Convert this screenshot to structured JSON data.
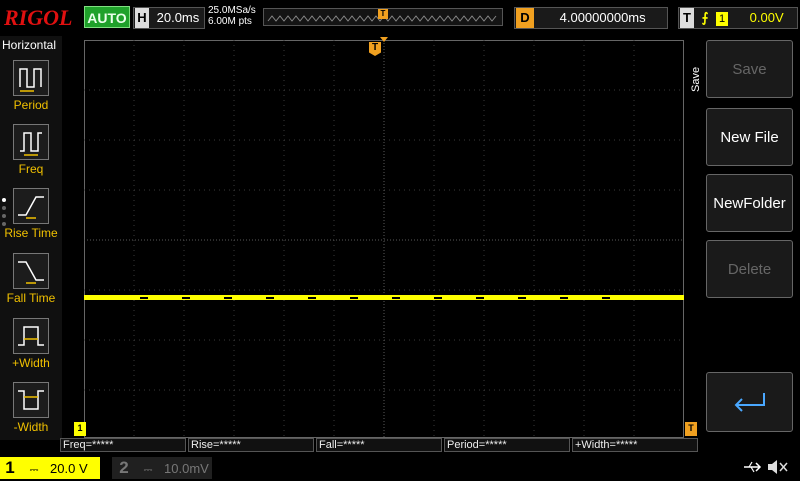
{
  "topbar": {
    "logo": "RIGOL",
    "run_mode": "AUTO",
    "h_label": "H",
    "timebase": "20.0ms",
    "sample_rate": "25.0MSa/s",
    "memory_depth": "6.00M pts",
    "trigger_marker": "T",
    "d_label": "D",
    "delay": "4.00000000ms",
    "t_label": "T",
    "trigger_source": "1",
    "trigger_level": "0.00V"
  },
  "left_menu": {
    "title": "Horizontal",
    "items": [
      {
        "label": "Period",
        "icon": "period-icon"
      },
      {
        "label": "Freq",
        "icon": "freq-icon"
      },
      {
        "label": "Rise Time",
        "icon": "rise-time-icon"
      },
      {
        "label": "Fall Time",
        "icon": "fall-time-icon"
      },
      {
        "label": "+Width",
        "icon": "positive-width-icon"
      },
      {
        "label": "-Width",
        "icon": "negative-width-icon"
      }
    ]
  },
  "right_menu": {
    "title": "Save",
    "buttons": [
      {
        "label": "Save",
        "enabled": false
      },
      {
        "label": "New File",
        "enabled": true
      },
      {
        "label": "NewFolder",
        "enabled": true
      },
      {
        "label": "Delete",
        "enabled": false
      }
    ],
    "return_icon": "return-arrow-icon"
  },
  "measurements": [
    "Freq=*****",
    "Rise=*****",
    "Fall=*****",
    "Period=*****",
    "+Width=*****"
  ],
  "channels": {
    "ch1": {
      "number": "1",
      "coupling_symbol": "⎓",
      "scale": "20.0 V"
    },
    "ch2": {
      "number": "2",
      "coupling_symbol": "⎓",
      "scale": "10.0mV"
    }
  },
  "status": {
    "usb_icon": "usb-icon",
    "sound_icon": "sound-muted-icon"
  },
  "colors": {
    "ch1": "#ffff00",
    "trigger": "#f0a020",
    "auto_green": "#1fa12a",
    "logo_red": "#e01010"
  }
}
